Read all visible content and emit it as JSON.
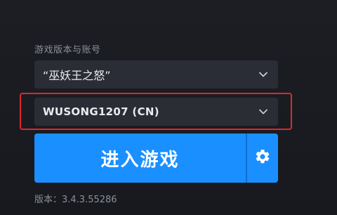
{
  "launcher": {
    "section_label": "游戏版本与账号",
    "game_select_value": "“巫妖王之怒”",
    "account_select_value": "WUSONG1207 (CN)",
    "play_label": "进入游戏",
    "version_text": "版本：3.4.3.55286"
  },
  "colors": {
    "accent": "#1a8fff",
    "highlight": "#e0272e",
    "background": "#191b21",
    "select_bg": "#2a2d35"
  },
  "icons": {
    "chevron": "chevron-down-icon",
    "settings": "gear-icon"
  }
}
